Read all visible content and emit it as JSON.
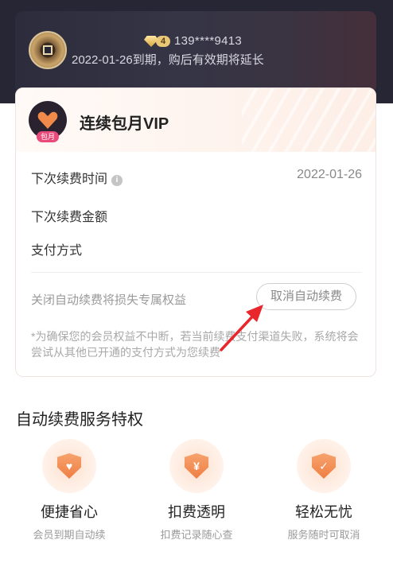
{
  "member": {
    "level": "4",
    "phone": "139****9413",
    "expire_text": "2022-01-26到期，购后有效期将延长"
  },
  "vip": {
    "title": "连续包月VIP",
    "tag": "包月",
    "next_renew_label": "下次续费时间",
    "next_renew_value": "2022-01-26",
    "next_amount_label": "下次续费金额",
    "pay_method_label": "支付方式",
    "close_hint": "关闭自动续费将损失专属权益",
    "cancel_label": "取消自动续费",
    "note": "*为确保您的会员权益不中断，若当前续费支付渠道失败，系统将会尝试从其他已开通的支付方式为您续费"
  },
  "privileges": {
    "title": "自动续费服务特权",
    "items": [
      {
        "title": "便捷省心",
        "sub": "会员到期自动续",
        "icon": "heart-shield-icon"
      },
      {
        "title": "扣费透明",
        "sub": "扣费记录随心查",
        "icon": "yen-shield-icon"
      },
      {
        "title": "轻松无忧",
        "sub": "服务随时可取消",
        "icon": "check-shield-icon"
      }
    ]
  },
  "colors": {
    "accent": "#f08a4b",
    "arrow": "#e8262b",
    "dark": "#262634"
  }
}
